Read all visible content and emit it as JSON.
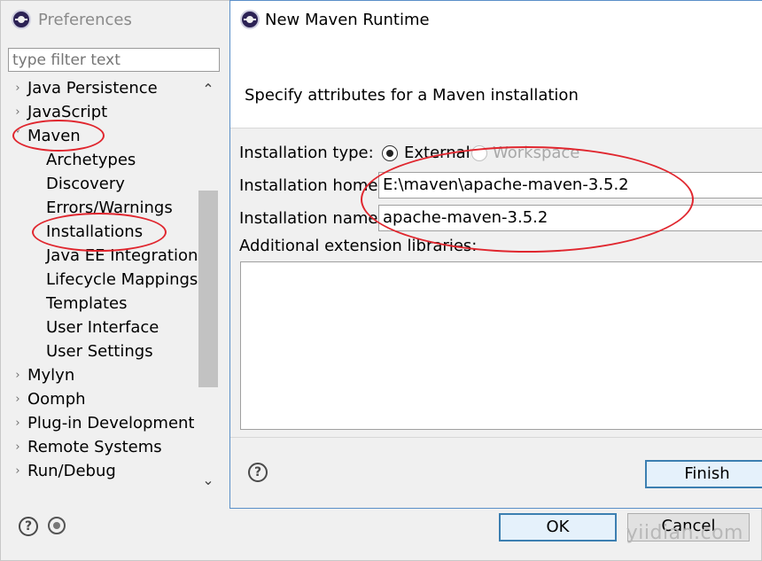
{
  "preferences": {
    "title": "Preferences",
    "filter_placeholder": "type filter text",
    "tree": [
      {
        "label": "Java Persistence",
        "expanded": false,
        "level": 0
      },
      {
        "label": "JavaScript",
        "expanded": false,
        "level": 0
      },
      {
        "label": "Maven",
        "expanded": true,
        "level": 0
      },
      {
        "label": "Archetypes",
        "level": 1
      },
      {
        "label": "Discovery",
        "level": 1
      },
      {
        "label": "Errors/Warnings",
        "level": 1
      },
      {
        "label": "Installations",
        "level": 1,
        "selected": true
      },
      {
        "label": "Java EE Integration",
        "level": 1
      },
      {
        "label": "Lifecycle Mappings",
        "level": 1
      },
      {
        "label": "Templates",
        "level": 1
      },
      {
        "label": "User Interface",
        "level": 1
      },
      {
        "label": "User Settings",
        "level": 1
      },
      {
        "label": "Mylyn",
        "expanded": false,
        "level": 0
      },
      {
        "label": "Oomph",
        "expanded": false,
        "level": 0
      },
      {
        "label": "Plug-in Development",
        "expanded": false,
        "level": 0
      },
      {
        "label": "Remote Systems",
        "expanded": false,
        "level": 0
      },
      {
        "label": "Run/Debug",
        "expanded": false,
        "level": 0
      }
    ],
    "ok_label": "OK",
    "cancel_label": "Cancel"
  },
  "dialog": {
    "title": "New Maven Runtime",
    "subtitle": "Specify attributes for a Maven installation",
    "installation_type_label": "Installation type:",
    "type_external": "External",
    "type_workspace": "Workspace",
    "selected_type": "External",
    "installation_home_label": "Installation home:",
    "installation_home_value": "E:\\maven\\apache-maven-3.5.2",
    "installation_name_label": "Installation name:",
    "installation_name_value": "apache-maven-3.5.2",
    "extension_libraries_label": "Additional extension libraries:",
    "finish_label": "Finish"
  },
  "watermark": "yiidian.com",
  "colors": {
    "annotation": "#e0262e",
    "default_button_border": "#3c7fb1"
  },
  "icons": {
    "app": "eclipse-icon",
    "help": "help-icon",
    "import": "import-preferences-icon",
    "tree_collapsed": "chevron-right-icon",
    "tree_expanded": "chevron-down-icon"
  }
}
